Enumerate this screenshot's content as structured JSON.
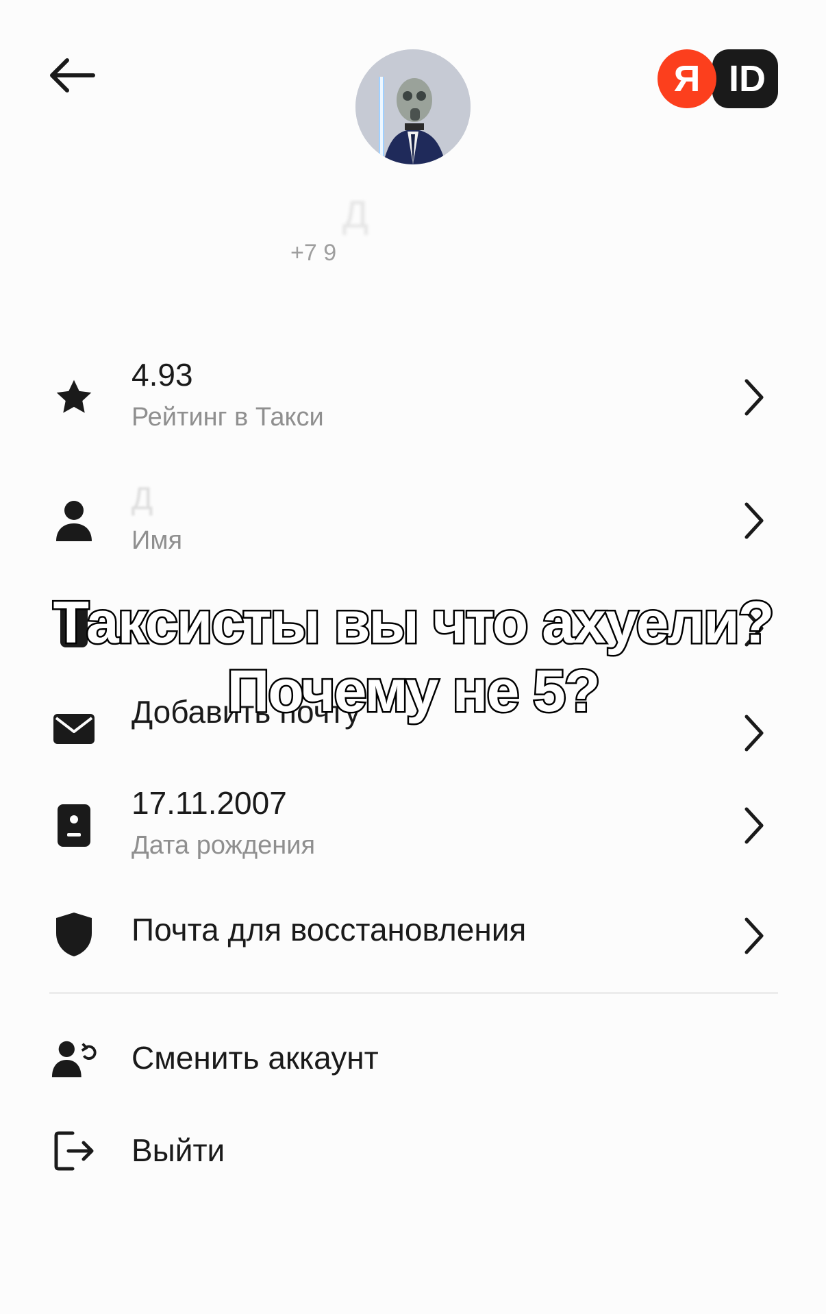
{
  "header": {
    "back_icon": "arrow-left-icon",
    "yandex_id_logo": {
      "ya": "Я",
      "id": "ID",
      "ya_color": "#fc3f1d",
      "id_color": "#1a1a1a"
    },
    "name": "Д",
    "phone": "+7 9"
  },
  "rows": [
    {
      "icon": "star-icon",
      "value": "4.93",
      "label": "Рейтинг в Такси"
    },
    {
      "icon": "person-icon",
      "value": "Д",
      "label": "Имя"
    },
    {
      "icon": "phone-icon",
      "value": "",
      "label": ""
    },
    {
      "icon": "mail-icon",
      "value": "Добавить почту",
      "label": ""
    },
    {
      "icon": "id-card-icon",
      "value": "17.11.2007",
      "label": "Дата рождения"
    },
    {
      "icon": "shield-icon",
      "value": "Почта для восстановления",
      "label": ""
    }
  ],
  "actions": [
    {
      "icon": "switch-account-icon",
      "label": "Сменить аккаунт"
    },
    {
      "icon": "logout-icon",
      "label": "Выйти"
    }
  ],
  "overlay": {
    "line1": "Таксисты вы что ахуели?",
    "line2": "Почему не 5?"
  }
}
